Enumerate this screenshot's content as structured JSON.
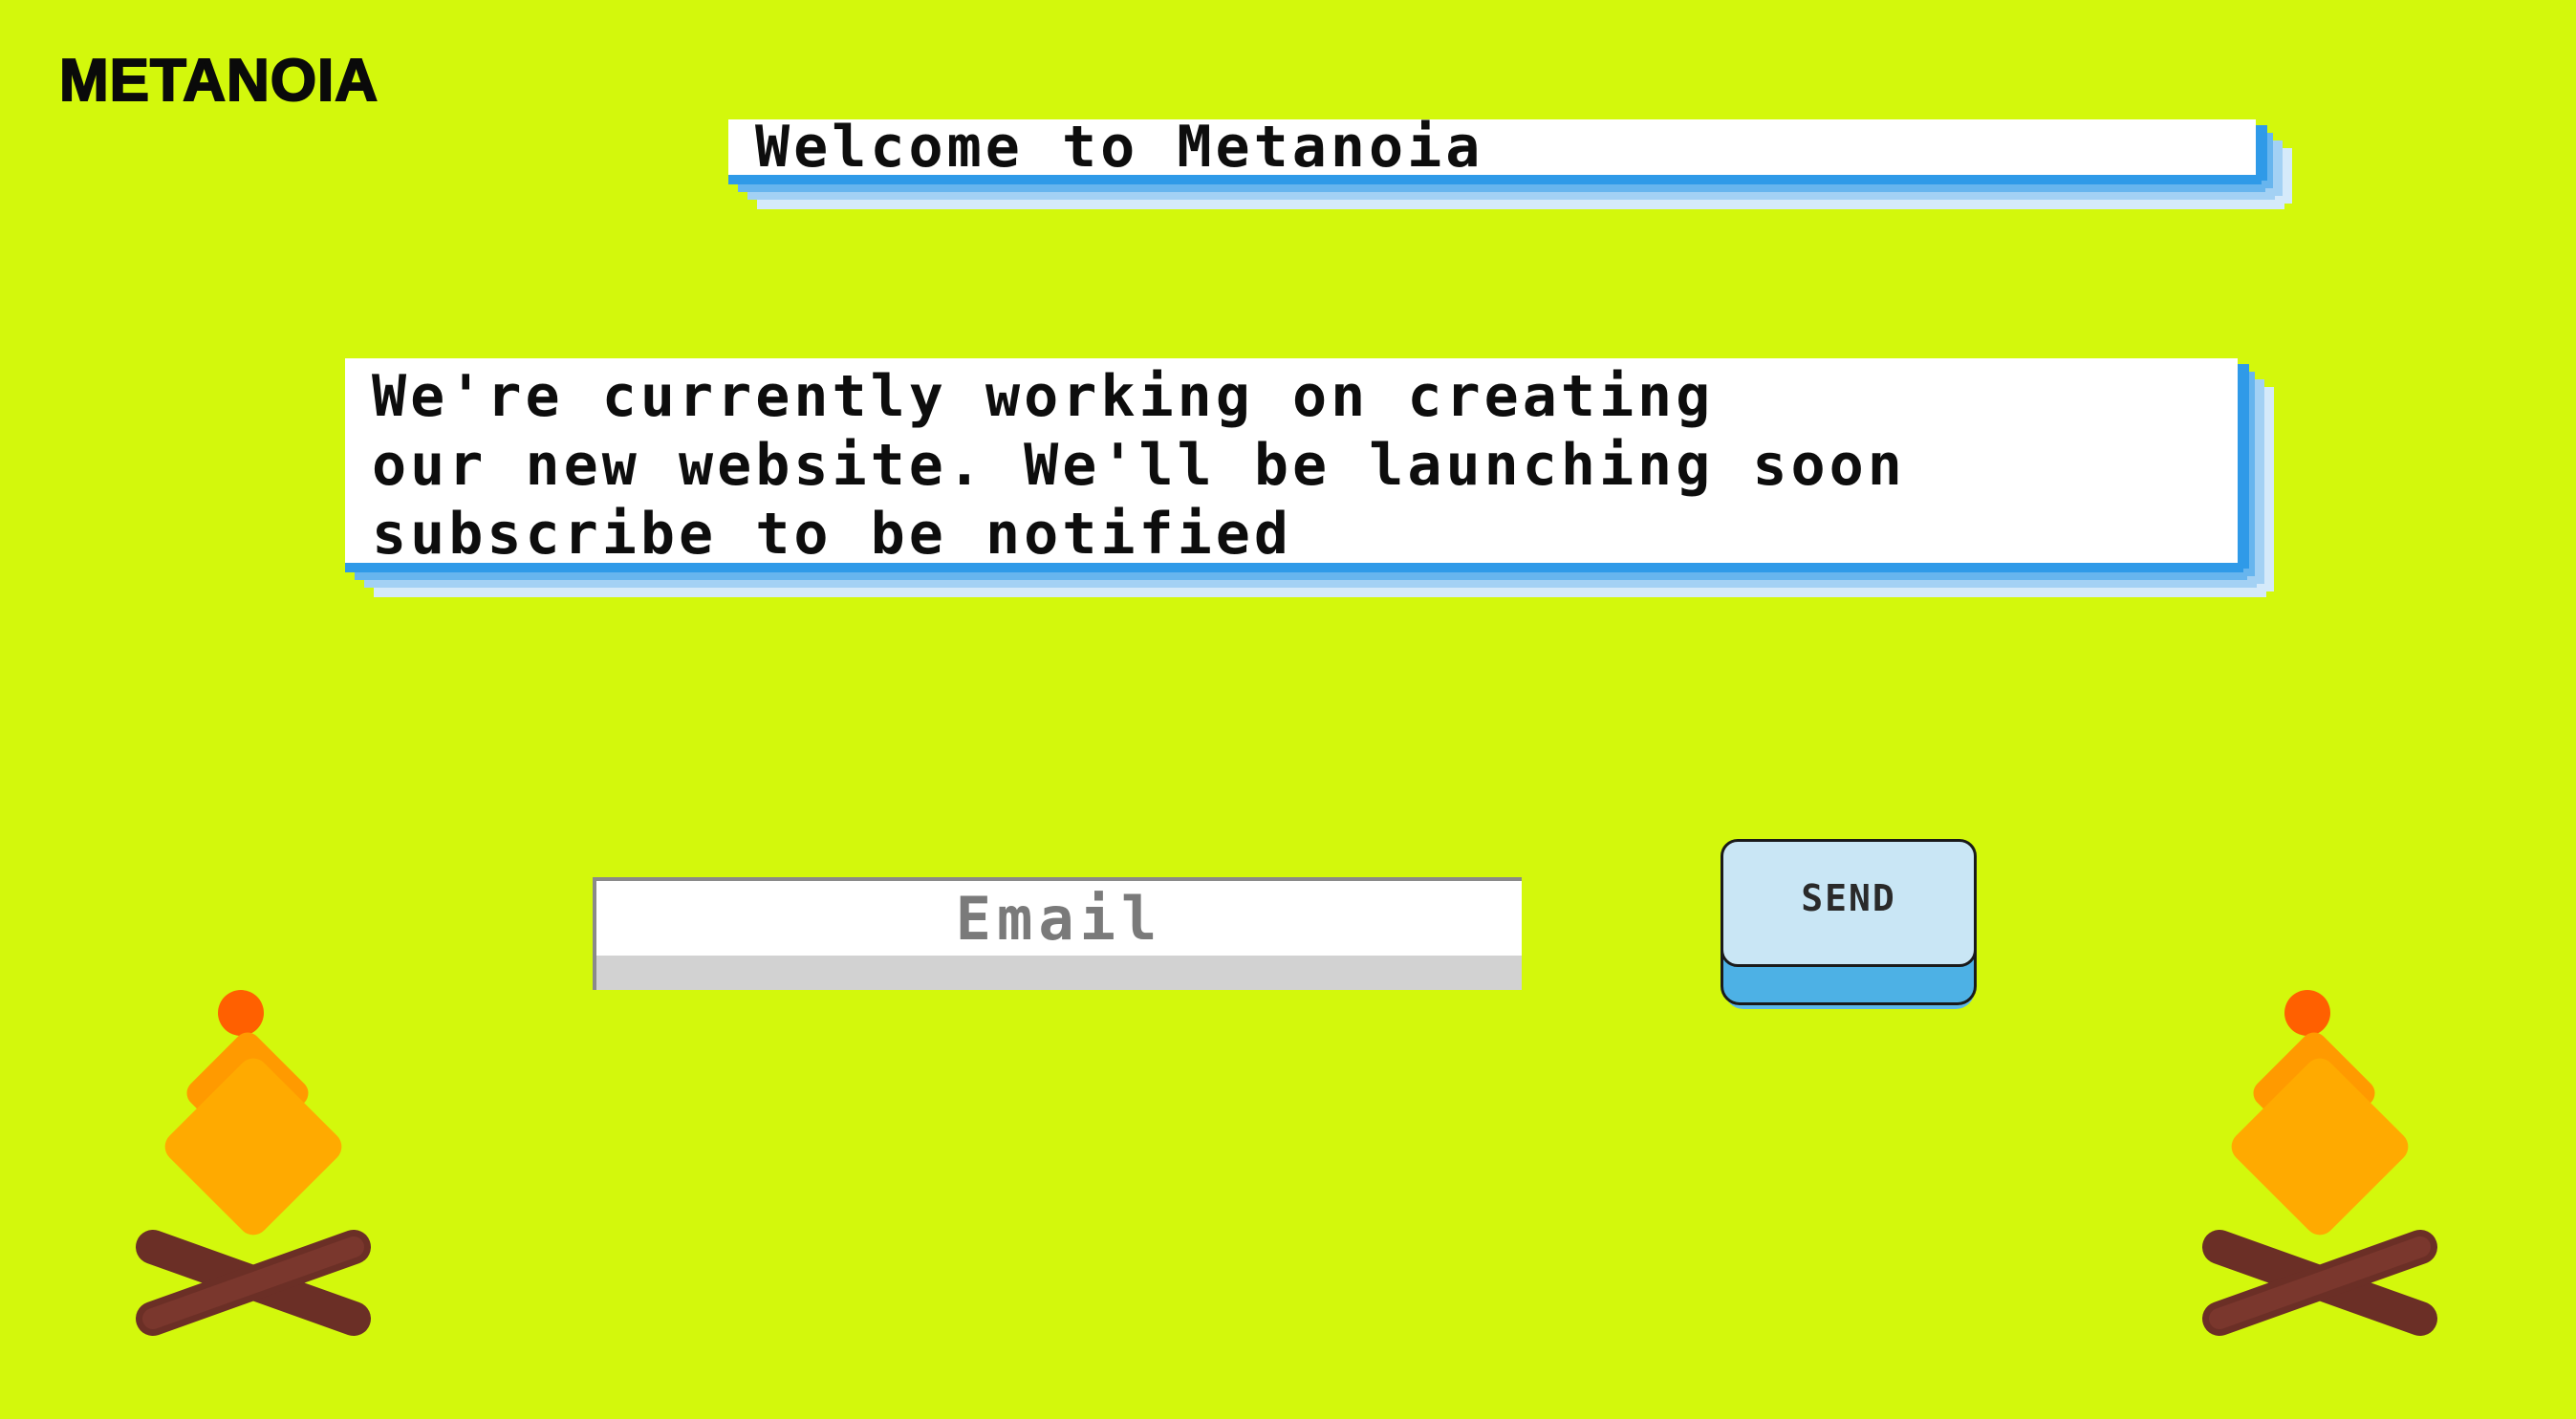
{
  "brand": {
    "logo": "METANOIA"
  },
  "hero": {
    "title": "Welcome to Metanoia",
    "message_lines": [
      "We're currently working on creating",
      "our new website. We'll be launching soon",
      "subscribe to be notified"
    ]
  },
  "subscribe": {
    "email_placeholder": "Email",
    "send_label": "SEND"
  },
  "colors": {
    "background": "#d3f80c",
    "card_shadow_blue": "#2f9ae8",
    "send_button_fill": "#c9e6f5",
    "send_button_base": "#4db1e5",
    "flame_orange": "#ffaa00",
    "ember_red": "#ff6000",
    "log_brown": "#6b2f26"
  },
  "decorations": {
    "left_icon": "campfire-icon",
    "right_icon": "campfire-icon"
  }
}
